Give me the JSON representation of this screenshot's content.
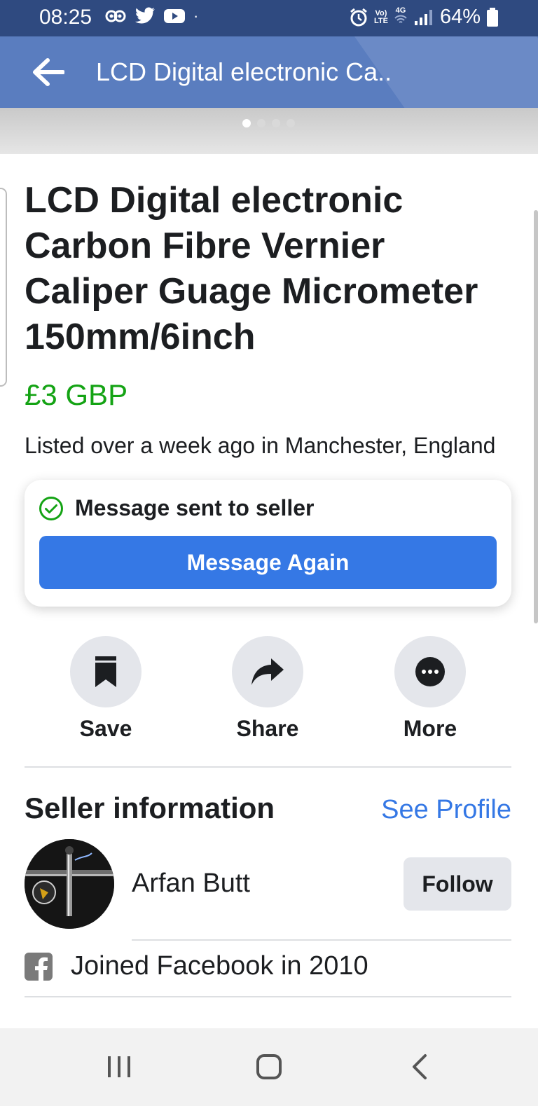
{
  "status_bar": {
    "time": "08:25",
    "battery": "64%",
    "network_top": "Vo)",
    "network_bottom": "LTE",
    "network_gen": "4G"
  },
  "header": {
    "title": "LCD Digital electronic Ca.."
  },
  "image_strip": {
    "pages": 4,
    "current_page": 1
  },
  "listing": {
    "title": "LCD Digital electronic Carbon Fibre Vernier Caliper Guage Micrometer 150mm/6inch",
    "price": "£3 GBP",
    "listed": "Listed over a week ago in Manchester, England"
  },
  "message_card": {
    "status": "Message sent to seller",
    "button": "Message Again"
  },
  "actions": {
    "save": "Save",
    "share": "Share",
    "more": "More"
  },
  "seller": {
    "heading": "Seller information",
    "see_profile": "See Profile",
    "name": "Arfan Butt",
    "follow": "Follow",
    "joined": "Joined Facebook in 2010"
  },
  "colors": {
    "status_bar": "#2f4a80",
    "header": "#5a7dbf",
    "price": "#14a314",
    "accent": "#3578e5"
  }
}
